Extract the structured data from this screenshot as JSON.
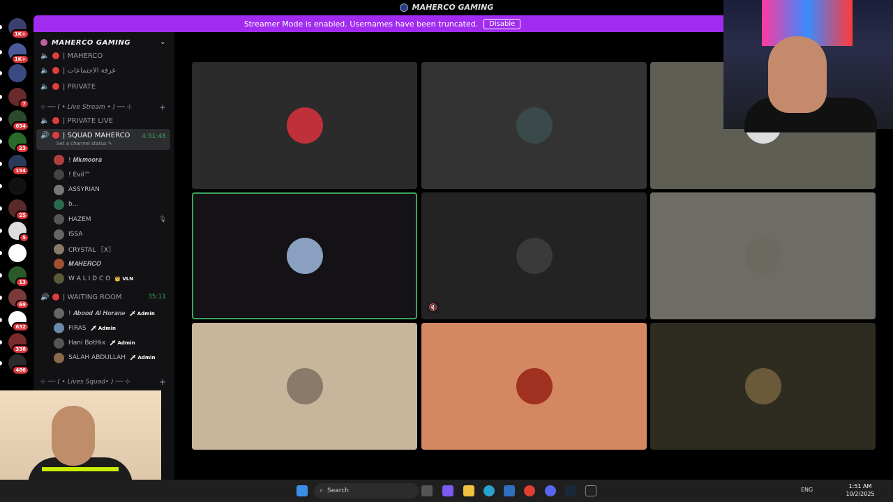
{
  "window": {
    "title": "MAHERCO GAMING"
  },
  "banner": {
    "text": "Streamer Mode is enabled. Usernames have been truncated.",
    "button": "Disable"
  },
  "servers": [
    {
      "badge": "1K+",
      "color": "#3b3f6e"
    },
    {
      "badge": "1K+",
      "color": "#4a5a9a"
    },
    {
      "badge": "",
      "color": "#3a4a80"
    },
    {
      "badge": "7",
      "color": "#6a2a2a"
    },
    {
      "badge": "654",
      "color": "#2a4a2a"
    },
    {
      "badge": "23",
      "color": "#2a6a2a"
    },
    {
      "badge": "154",
      "color": "#2a3a5a"
    },
    {
      "badge": "",
      "color": "#111111"
    },
    {
      "badge": "25",
      "color": "#5a2a2a"
    },
    {
      "badge": "5",
      "color": "#dddddd"
    },
    {
      "badge": "",
      "color": "#ffffff"
    },
    {
      "badge": "13",
      "color": "#2a5a2a"
    },
    {
      "badge": "69",
      "color": "#7a3a3a"
    },
    {
      "badge": "632",
      "color": "#ffffff"
    },
    {
      "badge": "338",
      "color": "#7a2a2a"
    },
    {
      "badge": "486",
      "color": "#2a2a2a"
    }
  ],
  "sidebar": {
    "guild_name": "MAHERCO GAMING",
    "channels_top": [
      {
        "name": "| MAHERCO"
      },
      {
        "name": "| غرفة الاجتماعات"
      },
      {
        "name": "| PRIVATE"
      }
    ],
    "category_live": "⊹ ── ( • Live Stream • ) ── ⊹",
    "channel_private_live": "| PRIVATE LIVE",
    "channel_squad": {
      "name": "| SQUAD MAHERCO",
      "time": "4:51:48",
      "status": "Set a channel status ✎"
    },
    "squad_users": [
      {
        "name": "! 𝑴𝒌𝒎𝒐𝒐𝒓𝒂",
        "color": "#b04040"
      },
      {
        "name": "! Evil™",
        "color": "#444"
      },
      {
        "name": "ASSYRIAN",
        "color": "#777"
      },
      {
        "name": "b...",
        "color": "#2a6a4a"
      },
      {
        "name": "HAZEM",
        "color": "#555"
      },
      {
        "name": "ISSA",
        "color": "#666"
      },
      {
        "name": "CRYSTAL 〖X〗",
        "color": "#8a7a6a"
      },
      {
        "name": "𝑴𝑨𝑯𝑬𝑹𝑪𝑶",
        "color": "#a05030"
      },
      {
        "name": "W A L I D C O",
        "color": "#5a5a3a",
        "tag": "👑 VLN"
      }
    ],
    "channel_waiting": {
      "name": "| WAITING ROOM",
      "time": "35:11"
    },
    "waiting_users": [
      {
        "name": "! 𝑨𝒃𝒐𝒐𝒅 𝑨𝒍 𝑯𝒐𝒓𝒂𝒏𝒆",
        "tag": "🗡 Admin",
        "color": "#666"
      },
      {
        "name": "FIRAS",
        "tag": "🗡 Admin",
        "color": "#6a8aaa"
      },
      {
        "name": "Hani BotHix",
        "tag": "🗡 Admin",
        "color": "#555"
      },
      {
        "name": "SALAH ABDULLAH",
        "tag": "🗡 Admin",
        "color": "#8a6a4a"
      }
    ],
    "category_squad": "⊹ ── ( • Lives Squad• ) ── ⊹"
  },
  "tiles": [
    {
      "bg": "#2b2b2b",
      "avatar": "#c0303a"
    },
    {
      "bg": "#333333",
      "avatar": "#3a4a4a"
    },
    {
      "bg": "#5f5e55",
      "avatar": "#ddd"
    },
    {
      "bg": "#141216",
      "avatar": "#8aa0c0",
      "speaking": true
    },
    {
      "bg": "#232323",
      "avatar": "#3a3a3a",
      "muted": true
    },
    {
      "bg": "#6e6c66",
      "avatar": "#6a6a60"
    },
    {
      "bg": "#c7b59c",
      "avatar": "#8a7a6a"
    },
    {
      "bg": "#d48862",
      "avatar": "#a03020"
    },
    {
      "bg": "#2e2c20",
      "avatar": "#6a5a3a"
    }
  ],
  "taskbar": {
    "search": "Search",
    "lang": "ENG",
    "time": "1:51 AM",
    "date": "10/2/2025"
  }
}
